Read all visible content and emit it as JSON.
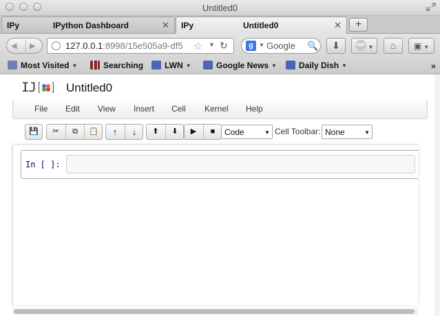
{
  "window": {
    "title": "Untitled0"
  },
  "tabs": [
    {
      "favicon": "IPy",
      "label": "IPython Dashboard",
      "close": "✕",
      "active": false
    },
    {
      "favicon": "IPy",
      "label": "Untitled0",
      "close": "✕",
      "active": true
    }
  ],
  "new_tab": "+",
  "url": {
    "host": "127.0.0.1",
    "rest": ":8998/15e505a9-df5"
  },
  "search": {
    "engine": "g",
    "placeholder": "Google"
  },
  "bookmarks": [
    {
      "label": "Most Visited",
      "icon": "folder-icon",
      "dropdown": true
    },
    {
      "label": "Searching",
      "icon": "books-icon",
      "dropdown": false
    },
    {
      "label": "LWN",
      "icon": "rss-feed-icon",
      "dropdown": true
    },
    {
      "label": "Google News",
      "icon": "rss-feed-icon",
      "dropdown": true
    },
    {
      "label": "Daily Dish",
      "icon": "rss-feed-icon",
      "dropdown": true
    }
  ],
  "notebook": {
    "logo": "IJ",
    "title": "Untitled0",
    "menu": [
      "File",
      "Edit",
      "View",
      "Insert",
      "Cell",
      "Kernel",
      "Help"
    ],
    "cell_type": "Code",
    "cell_toolbar_label": "Cell Toolbar:",
    "cell_toolbar_value": "None",
    "cell": {
      "prompt": "In [ ]:",
      "source": ""
    }
  },
  "colors": {
    "prompt": "#000080",
    "logo_blue": "#4a6fbf",
    "logo_orange": "#e0762b",
    "logo_green": "#4aa64a",
    "logo_red": "#d23c3c"
  }
}
